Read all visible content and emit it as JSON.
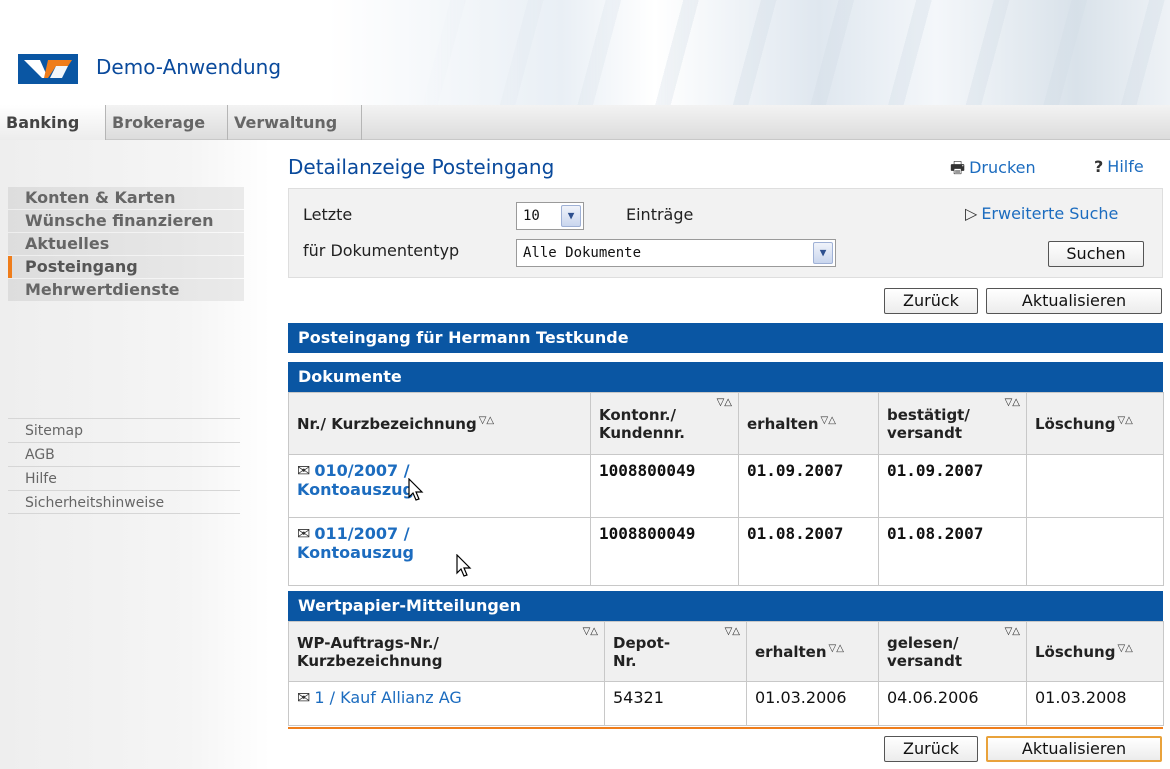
{
  "header": {
    "app_title": "Demo-Anwendung",
    "logo": "volksbank-logo"
  },
  "topnav": {
    "items": [
      {
        "label": "Banking",
        "active": true
      },
      {
        "label": "Brokerage",
        "active": false
      },
      {
        "label": "Verwaltung",
        "active": false
      }
    ]
  },
  "sidebar": {
    "main_items": [
      {
        "label": "Konten & Karten",
        "active": false
      },
      {
        "label": "Wünsche finanzieren",
        "active": false
      },
      {
        "label": "Aktuelles",
        "active": false
      },
      {
        "label": "Posteingang",
        "active": true
      },
      {
        "label": "Mehrwertdienste",
        "active": false
      }
    ],
    "links": [
      {
        "label": "Sitemap"
      },
      {
        "label": "AGB"
      },
      {
        "label": "Hilfe"
      },
      {
        "label": "Sicherheitshinweise"
      }
    ]
  },
  "main": {
    "title": "Detailanzeige Posteingang",
    "print_label": "Drucken",
    "help_label": "Hilfe",
    "filter": {
      "last_label": "Letzte",
      "count_value": "10",
      "entries_label": "Einträge",
      "doctype_label": "für Dokumententyp",
      "doctype_value": "Alle Dokumente",
      "extended_search": "Erweiterte Suche",
      "search_button": "Suchen"
    },
    "buttons": {
      "back": "Zurück",
      "refresh": "Aktualisieren"
    },
    "inbox_header": "Posteingang für Hermann Testkunde",
    "documents": {
      "section_title": "Dokumente",
      "columns": [
        "Nr./ Kurzbezeichnung",
        "Kontonr./ Kundennr.",
        "erhalten",
        "bestätigt/ versandt",
        "Löschung"
      ],
      "rows": [
        {
          "nr": "010/2007 /",
          "bez": "Kontoauszug",
          "konto": "1008800049",
          "erhalten": "01.09.2007",
          "bestaetigt": "01.09.2007",
          "loeschung": ""
        },
        {
          "nr": "011/2007 /",
          "bez": "Kontoauszug",
          "konto": "1008800049",
          "erhalten": "01.08.2007",
          "bestaetigt": "01.08.2007",
          "loeschung": ""
        }
      ]
    },
    "wp": {
      "section_title": "Wertpapier-Mitteilungen",
      "columns": [
        "WP-Auftrags-Nr./ Kurzbezeichnung",
        "Depot- Nr.",
        "erhalten",
        "gelesen/ versandt",
        "Löschung"
      ],
      "rows": [
        {
          "bez": "1 / Kauf Allianz AG",
          "depot": "54321",
          "erhalten": "01.03.2006",
          "gelesen": "04.06.2006",
          "loeschung": "01.03.2008"
        }
      ]
    }
  },
  "icons": {
    "print": "printer-icon",
    "help": "help-icon",
    "envelope": "envelope-icon",
    "sort": "sort-arrows-icon"
  },
  "colors": {
    "brand_blue": "#0a56a3",
    "link_blue": "#1c6cbf",
    "accent_orange": "#ef7d1b"
  }
}
